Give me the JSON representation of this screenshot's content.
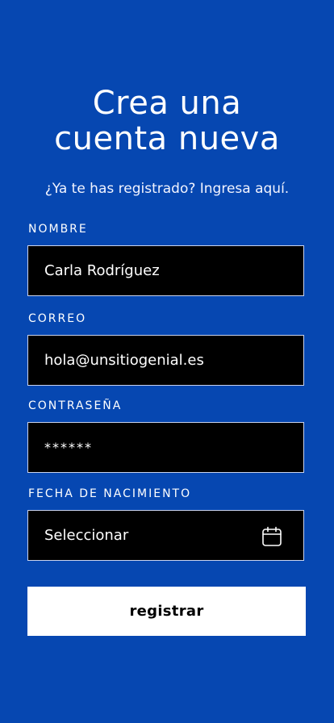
{
  "header": {
    "title_line1": "Crea una",
    "title_line2": "cuenta nueva",
    "subtitle": "¿Ya te has registrado? Ingresa aquí."
  },
  "form": {
    "name": {
      "label": "NOMBRE",
      "value": "Carla Rodríguez"
    },
    "email": {
      "label": "CORREO",
      "value": "hola@unsitiogenial.es"
    },
    "password": {
      "label": "CONTRASEÑA",
      "value": "******"
    },
    "birthdate": {
      "label": "FECHA DE NACIMIENTO",
      "value": "Seleccionar",
      "icon": "calendar-icon"
    },
    "submit_label": "registrar"
  },
  "colors": {
    "background": "#0647b1",
    "field_background": "#000000",
    "button_background": "#ffffff"
  }
}
